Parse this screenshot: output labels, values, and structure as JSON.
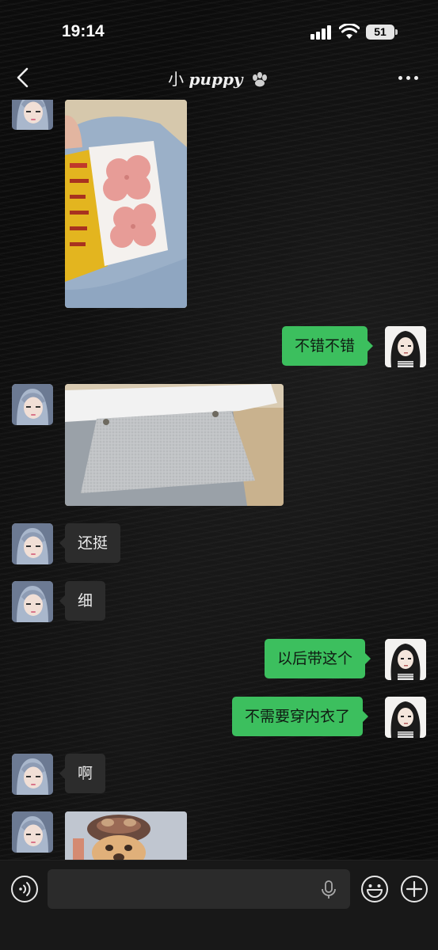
{
  "status_bar": {
    "time": "19:14",
    "battery": "51",
    "icons": [
      "signal-icon",
      "wifi-icon",
      "battery-icon"
    ]
  },
  "header": {
    "title_prefix": "小",
    "title_name": "puppy",
    "title_emoji_icon": "paw-icon",
    "back_icon": "chevron-left-icon",
    "more_icon": "more-dots-icon"
  },
  "messages": [
    {
      "side": "other",
      "type": "image",
      "content": "photo of pink flower-shaped stickers on packaging"
    },
    {
      "side": "mine",
      "type": "text",
      "text": "不错不错"
    },
    {
      "side": "other",
      "type": "image",
      "content": "photo of a grey textured strip"
    },
    {
      "side": "other",
      "type": "text",
      "text": "还挺"
    },
    {
      "side": "other",
      "type": "text",
      "text": "细"
    },
    {
      "side": "mine",
      "type": "text",
      "text": "以后带这个"
    },
    {
      "side": "mine",
      "type": "text",
      "text": "不需要穿内衣了"
    },
    {
      "side": "other",
      "type": "text",
      "text": "啊"
    },
    {
      "side": "other",
      "type": "image",
      "content": "photo of a dog with a hat"
    }
  ],
  "input_bar": {
    "placeholder": "",
    "icons": [
      "voice-icon",
      "microphone-icon",
      "emoji-icon",
      "plus-icon"
    ]
  },
  "colors": {
    "my_bubble": "#3cbf5e",
    "other_bubble": "#2c2c2c",
    "background": "#0c0c0c"
  }
}
